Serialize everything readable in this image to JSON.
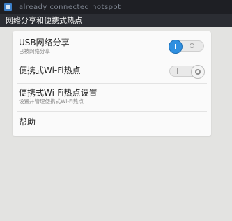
{
  "status_bar": {
    "notification_text": "already connected hotspot"
  },
  "header": {
    "title": "网络分享和便携式热点"
  },
  "settings": {
    "usb": {
      "title": "USB网络分享",
      "subtitle": "已被网络分享",
      "switch_state": "on"
    },
    "wifi_hotspot": {
      "title": "便携式Wi-Fi热点",
      "switch_state": "off"
    },
    "hotspot_settings": {
      "title": "便携式Wi-Fi热点设置",
      "subtitle": "设置并管理便携式Wi-Fi热点"
    },
    "help": {
      "title": "帮助"
    }
  },
  "colors": {
    "status_bar_bg": "#1e1f24",
    "header_bg": "#2b2d33",
    "page_bg": "#e3e3e1",
    "card_bg": "#fafafa",
    "switch_on_accent": "#2f8fe0"
  },
  "icons": {
    "status_notification": "notification-icon"
  }
}
